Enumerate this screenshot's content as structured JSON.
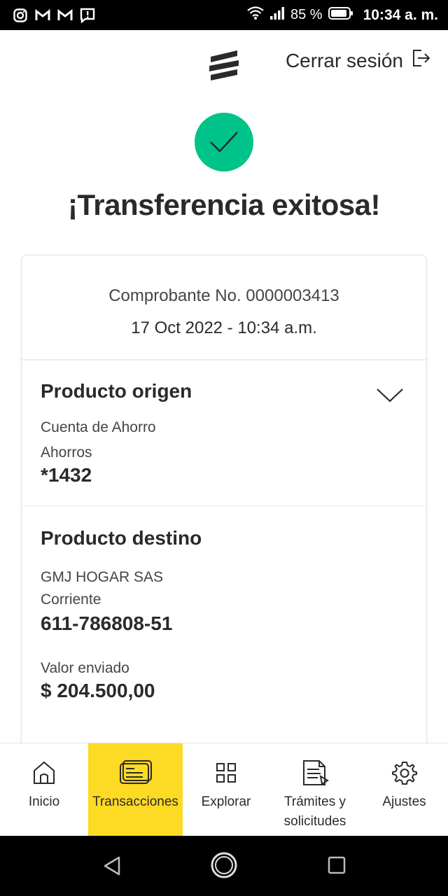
{
  "status_bar": {
    "battery": "85 %",
    "time": "10:34 a. m.",
    "left_icons": [
      "instagram-icon",
      "gmail-icon",
      "gmail-icon",
      "alert-icon"
    ]
  },
  "header": {
    "logout_label": "Cerrar sesión"
  },
  "page": {
    "title": "¡Transferencia exitosa!"
  },
  "receipt": {
    "number": "Comprobante No. 0000003413",
    "datetime": "17 Oct 2022 - 10:34 a.m."
  },
  "origin": {
    "heading": "Producto origen",
    "account_type": "Cuenta de Ahorro",
    "account_kind": "Ahorros",
    "account_number": "*1432"
  },
  "destination": {
    "heading": "Producto destino",
    "name": "GMJ HOGAR SAS",
    "account_kind": "Corriente",
    "account_number": "611-786808-51",
    "amount_label": "Valor enviado",
    "amount": "$ 204.500,00"
  },
  "bottom_nav": {
    "items": [
      {
        "label": "Inicio",
        "icon": "home-icon"
      },
      {
        "label": "Transacciones",
        "icon": "transactions-icon",
        "active": true
      },
      {
        "label": "Explorar",
        "icon": "grid-icon"
      },
      {
        "label": "Trámites y solicitudes",
        "line1": "Trámites y",
        "line2": "solicitudes",
        "icon": "document-icon"
      },
      {
        "label": "Ajustes",
        "icon": "gear-icon"
      }
    ]
  },
  "colors": {
    "success": "#00c389",
    "accent_yellow": "#fdda24",
    "text_dark": "#2c2a29"
  }
}
